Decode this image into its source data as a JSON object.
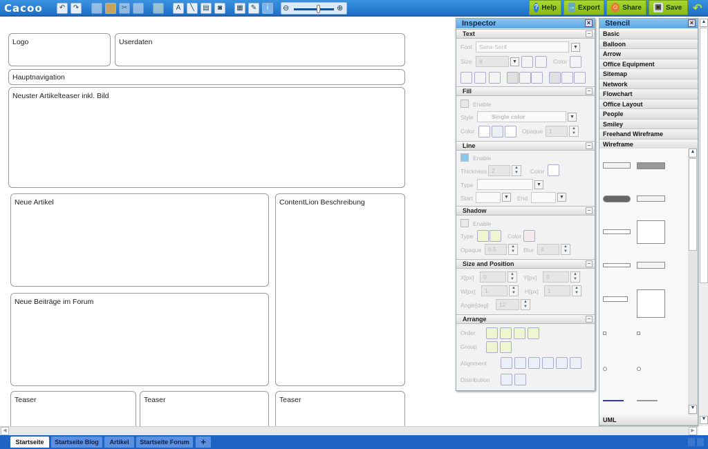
{
  "toolbar": {
    "logo": "Cacoo",
    "zoom_level": 0.6,
    "help": "Help",
    "export": "Export",
    "share": "Share",
    "save": "Save"
  },
  "canvas": {
    "shapes": [
      "Logo",
      "Userdaten",
      "Hauptnavigation",
      "Neuster Artikelteaser inkl. Bild",
      "Neue Artikel",
      "ContentLion Beschreibung",
      "Neue Beiträge im Forum",
      "Teaser",
      "Teaser",
      "Teaser"
    ]
  },
  "inspector": {
    "title": "Inspector",
    "text": {
      "header": "Text",
      "font_label": "Font",
      "font_value": "Sans-Serif",
      "size_label": "Size",
      "size_value": "8",
      "color_label": "Color"
    },
    "fill": {
      "header": "Fill",
      "enable": "Enable",
      "style_label": "Style",
      "style_value": "Single color",
      "color_label": "Color",
      "opaque_label": "Opaque",
      "opaque_value": "1"
    },
    "line": {
      "header": "Line",
      "enable": "Enable",
      "thickness_label": "Thickness",
      "thickness_value": "2",
      "color_label": "Color",
      "type_label": "Type",
      "start_label": "Start",
      "end_label": "End"
    },
    "shadow": {
      "header": "Shadow",
      "enable": "Enable",
      "type_label": "Type",
      "color_label": "Color",
      "opaque_label": "Opaque",
      "opaque_value": "0.5",
      "blur_label": "Blur",
      "blur_value": "4"
    },
    "size": {
      "header": "Size and Position",
      "x_label": "X[px]",
      "x_value": "0",
      "y_label": "Y[px]",
      "y_value": "0",
      "w_label": "W[px]",
      "w_value": "1",
      "h_label": "H[px]",
      "h_value": "1",
      "angle_label": "Angle[deg]",
      "angle_value": "12"
    },
    "arrange": {
      "header": "Arrange",
      "order": "Order",
      "group": "Group",
      "alignment": "Alignment",
      "distribution": "Distribution"
    }
  },
  "stencil": {
    "title": "Stencil",
    "categories": [
      "Basic",
      "Balloon",
      "Arrow",
      "Office Equipment",
      "Sitemap",
      "Network",
      "Flowchart",
      "Office Layout",
      "People",
      "Smiley",
      "Freehand Wireframe",
      "Wireframe"
    ],
    "bottom": "UML"
  },
  "tabs": [
    "Startseite",
    "Startseite Blog",
    "Artikel",
    "Startseite Forum"
  ],
  "add_tab": "+"
}
